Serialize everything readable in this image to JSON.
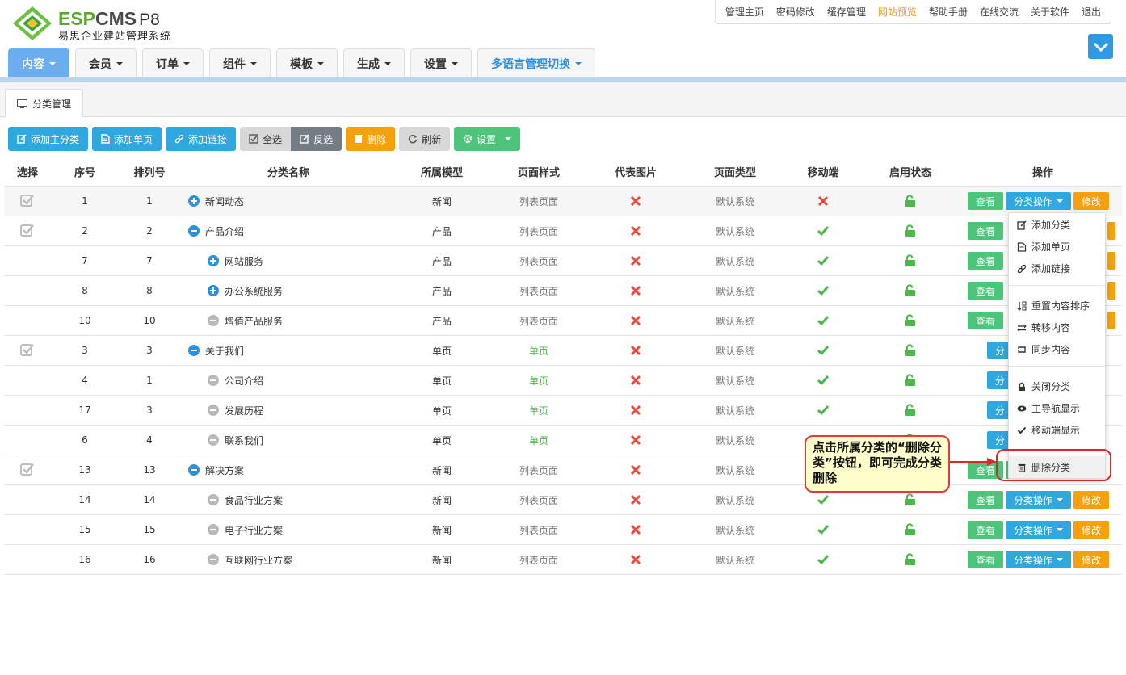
{
  "brand": {
    "esp": "ESP",
    "cms": "CMS",
    "ver": "P8",
    "subtitle": "易思企业建站管理系统"
  },
  "toplinks": [
    {
      "label": "管理主页"
    },
    {
      "label": "密码修改"
    },
    {
      "label": "缓存管理"
    },
    {
      "label": "网站预览",
      "highlight": true
    },
    {
      "label": "帮助手册"
    },
    {
      "label": "在线交流"
    },
    {
      "label": "关于软件"
    },
    {
      "label": "退出"
    }
  ],
  "nav": {
    "tabs": [
      "内容",
      "会员",
      "订单",
      "组件",
      "模板",
      "生成",
      "设置",
      "多语言管理切换"
    ],
    "active": 0
  },
  "subtab": {
    "label": "分类管理"
  },
  "toolbar": {
    "add_main": "添加主分类",
    "add_page": "添加单页",
    "add_link": "添加链接",
    "select_all": "全选",
    "invert": "反选",
    "delete": "删除",
    "refresh": "刷新",
    "settings": "设置"
  },
  "table": {
    "headers": [
      "选择",
      "序号",
      "排列号",
      "分类名称",
      "所属模型",
      "页面样式",
      "代表图片",
      "页面类型",
      "移动端",
      "启用状态",
      "操作"
    ],
    "ops": {
      "view": "查看",
      "cat_ops": "分类操作",
      "edit": "修改",
      "cat_short": "分"
    },
    "rows": [
      {
        "check": true,
        "id": "1",
        "ord": "1",
        "name": "新闻动态",
        "level": 1,
        "node": "plus",
        "model": "新闻",
        "style": "列表页面",
        "style_green": false,
        "mobile": false
      },
      {
        "check": true,
        "id": "2",
        "ord": "2",
        "name": "产品介绍",
        "level": 1,
        "node": "minus",
        "model": "产品",
        "style": "列表页面",
        "style_green": false,
        "mobile": true
      },
      {
        "check": false,
        "id": "7",
        "ord": "7",
        "name": "网站服务",
        "level": 2,
        "node": "plus",
        "model": "产品",
        "style": "列表页面",
        "style_green": false,
        "mobile": true
      },
      {
        "check": false,
        "id": "8",
        "ord": "8",
        "name": "办公系统服务",
        "level": 2,
        "node": "plus",
        "model": "产品",
        "style": "列表页面",
        "style_green": false,
        "mobile": true
      },
      {
        "check": false,
        "id": "10",
        "ord": "10",
        "name": "增值产品服务",
        "level": 2,
        "node": "leaf",
        "model": "产品",
        "style": "列表页面",
        "style_green": false,
        "mobile": true
      },
      {
        "check": true,
        "id": "3",
        "ord": "3",
        "name": "关于我们",
        "level": 1,
        "node": "minus",
        "model": "单页",
        "style": "单页",
        "style_green": true,
        "mobile": true
      },
      {
        "check": false,
        "id": "4",
        "ord": "1",
        "name": "公司介绍",
        "level": 2,
        "node": "leaf",
        "model": "单页",
        "style": "单页",
        "style_green": true,
        "mobile": true
      },
      {
        "check": false,
        "id": "17",
        "ord": "3",
        "name": "发展历程",
        "level": 2,
        "node": "leaf",
        "model": "单页",
        "style": "单页",
        "style_green": true,
        "mobile": true
      },
      {
        "check": false,
        "id": "6",
        "ord": "4",
        "name": "联系我们",
        "level": 2,
        "node": "leaf",
        "model": "单页",
        "style": "单页",
        "style_green": true,
        "mobile": false
      },
      {
        "check": true,
        "id": "13",
        "ord": "13",
        "name": "解决方案",
        "level": 1,
        "node": "minus",
        "model": "新闻",
        "style": "列表页面",
        "style_green": false,
        "mobile": null
      },
      {
        "check": false,
        "id": "14",
        "ord": "14",
        "name": "食品行业方案",
        "level": 2,
        "node": "leaf",
        "model": "新闻",
        "style": "列表页面",
        "style_green": false,
        "mobile": true
      },
      {
        "check": false,
        "id": "15",
        "ord": "15",
        "name": "电子行业方案",
        "level": 2,
        "node": "leaf",
        "model": "新闻",
        "style": "列表页面",
        "style_green": false,
        "mobile": true
      },
      {
        "check": false,
        "id": "16",
        "ord": "16",
        "name": "互联网行业方案",
        "level": 2,
        "node": "leaf",
        "model": "新闻",
        "style": "列表页面",
        "style_green": false,
        "mobile": true
      }
    ],
    "page_type": "默认系统"
  },
  "dropdown": {
    "items": [
      {
        "label": "添加分类",
        "icon": "edit-icon"
      },
      {
        "label": "添加单页",
        "icon": "file-icon"
      },
      {
        "label": "添加链接",
        "icon": "link-icon"
      },
      {
        "label": "重置内容排序",
        "icon": "sort-icon"
      },
      {
        "label": "转移内容",
        "icon": "exchange-icon"
      },
      {
        "label": "同步内容",
        "icon": "sync-icon"
      },
      {
        "label": "关闭分类",
        "icon": "lock-icon"
      },
      {
        "label": "主导航显示",
        "icon": "eye-icon"
      },
      {
        "label": "移动端显示",
        "icon": "check-icon"
      },
      {
        "label": "删除分类",
        "icon": "trash-icon"
      }
    ]
  },
  "callout": {
    "text": "点击所属分类的“删除分类”按钮，即可完成分类删除"
  },
  "colors": {
    "blue": "#2fa7e0",
    "green": "#4cc47a",
    "orange": "#f5a00c",
    "red": "#e74c3c",
    "nav_active": "#6aaef0"
  }
}
